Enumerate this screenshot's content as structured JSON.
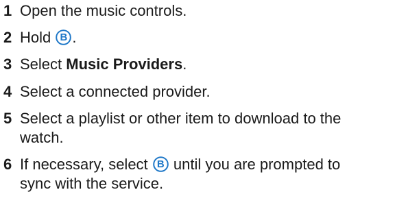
{
  "steps": [
    {
      "num": "1",
      "text": "Open the music controls."
    },
    {
      "num": "2",
      "text_before": "Hold ",
      "button": "B",
      "text_after": "."
    },
    {
      "num": "3",
      "text_before": "Select ",
      "bold": "Music Providers",
      "text_after": "."
    },
    {
      "num": "4",
      "text": "Select a connected provider."
    },
    {
      "num": "5",
      "line1": "Select a playlist or other item to download to the",
      "line2": "watch."
    },
    {
      "num": "6",
      "line1_before": "If necessary, select ",
      "button": "B",
      "line1_after": " until you are prompted to",
      "line2": "sync with the service."
    }
  ],
  "colors": {
    "text": "#1a1a1a",
    "button_accent": "#1f78c8"
  },
  "icons": {
    "button": "circled-b-button-icon"
  }
}
